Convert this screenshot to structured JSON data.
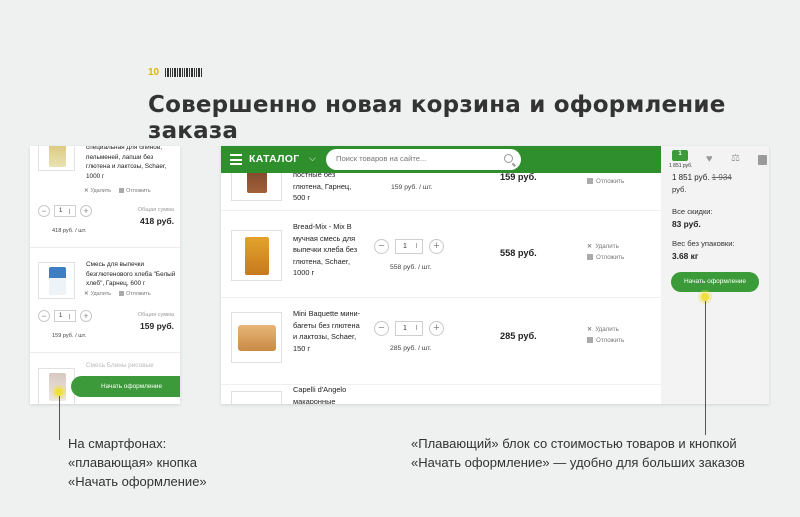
{
  "slide": {
    "number": "10"
  },
  "headline": "Совершенно новая корзина и оформление заказа",
  "mobile": {
    "items": [
      {
        "name": "специальная для блинов, пельменей, лапши без глютена и лактозы, Schaer, 1000 г",
        "delete": "Удалить",
        "postpone": "Отложить",
        "qty": "1",
        "sum_label": "Общая сумма",
        "price": "418 руб.",
        "unit_price": "418 руб. / шт."
      },
      {
        "name": "Смесь для выпечки безглютенового хлеба \"Белый хлеб\", Гарнец, 600 г",
        "delete": "Удалить",
        "postpone": "Отложить",
        "qty": "1",
        "sum_label": "Общая сумма",
        "price": "159 руб.",
        "unit_price": "159 руб. / шт."
      }
    ],
    "faded_item": "Смесь Блины рисовые",
    "float_button": "Начать оформление"
  },
  "desktop": {
    "header": {
      "catalog": "КАТАЛОГ",
      "search_placeholder": "Поиск товаров на сайте...",
      "cart_count": "1",
      "cart_sum": "1 851 руб."
    },
    "rows": [
      {
        "name": "постные без глютена, Гарнец, 500 г",
        "unit_price": "159 руб. / шт.",
        "price": "159 руб.",
        "postpone": "Отложить"
      },
      {
        "name": "Bread-Mix - Mix B мучная смесь для выпечки хлеба без глютена, Schaer, 1000 г",
        "qty": "1",
        "unit_price": "558 руб. / шт.",
        "price": "558 руб.",
        "delete": "Удалить",
        "postpone": "Отложить"
      },
      {
        "name": "Mini Baquette мини-багеты без глютена и лактозы, Schaer, 150 г",
        "qty": "1",
        "unit_price": "285 руб. / шт.",
        "price": "285 руб.",
        "delete": "Удалить",
        "postpone": "Отложить"
      },
      {
        "name": "Capelli d'Angelo макаронные"
      }
    ],
    "summary": {
      "total": "1 851 руб.",
      "old_total": "1 934",
      "currency": "руб.",
      "discount_label": "Все скидки:",
      "discount": "83 руб.",
      "weight_label": "Вес без упаковки:",
      "weight": "3.68 кг",
      "button": "Начать оформление"
    }
  },
  "captions": {
    "mobile": [
      "На смартфонах:",
      "«плавающая» кнопка",
      "«Начать оформление»"
    ],
    "desktop": [
      "«Плавающий» блок со стоимостью товаров и кнопкой",
      "«Начать оформление» — удобно для больших заказов"
    ]
  },
  "colors": {
    "accent_green": "#2f8f2d",
    "button_green": "#3a9b38",
    "marker_yellow": "#f2e03a",
    "slide_num": "#e0b400"
  }
}
